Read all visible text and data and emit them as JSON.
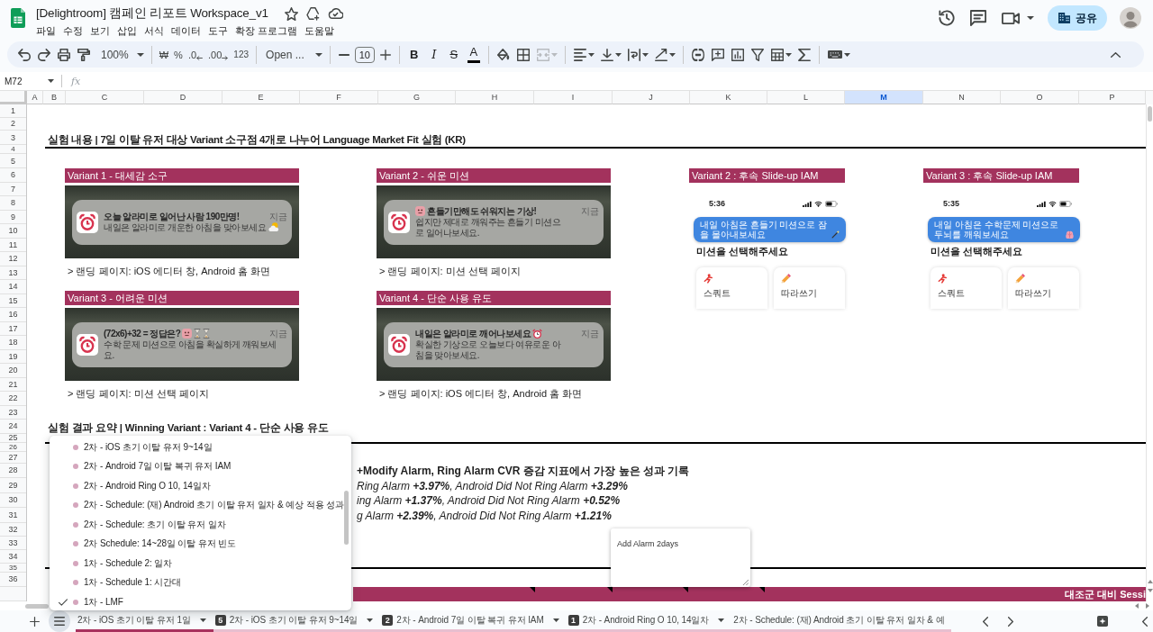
{
  "app": {
    "title": "[Delightroom] 캠페인 리포트 Workspace_v1",
    "menu": [
      "파일",
      "수정",
      "보기",
      "삽입",
      "서식",
      "데이터",
      "도구",
      "확장 프로그램",
      "도움말"
    ],
    "share_button": "공유"
  },
  "toolbar": {
    "zoom": "100%",
    "currency": "₩",
    "percent": "%",
    "decrease_decimals": ".0",
    "increase_decimals": ".00",
    "number_format": "123",
    "font": "Open ...",
    "font_size": "10",
    "bold": "B",
    "italic": "I",
    "strikethrough": "S",
    "text_color": "A",
    "merge_disabled": true
  },
  "formula_bar": {
    "cell": "M72",
    "fx": "fx"
  },
  "columns": [
    {
      "label": "A",
      "selected": false
    },
    {
      "label": "B",
      "selected": false
    },
    {
      "label": "C",
      "selected": false
    },
    {
      "label": "D",
      "selected": false
    },
    {
      "label": "E",
      "selected": false
    },
    {
      "label": "F",
      "selected": false
    },
    {
      "label": "G",
      "selected": false
    },
    {
      "label": "H",
      "selected": false
    },
    {
      "label": "I",
      "selected": false
    },
    {
      "label": "J",
      "selected": false
    },
    {
      "label": "K",
      "selected": false
    },
    {
      "label": "L",
      "selected": false
    },
    {
      "label": "M",
      "selected": true
    },
    {
      "label": "N",
      "selected": false
    },
    {
      "label": "O",
      "selected": false
    },
    {
      "label": "P",
      "selected": false
    }
  ],
  "rows": [
    "1",
    "2",
    "3",
    "4",
    "5",
    "6",
    "7",
    "8",
    "9",
    "10",
    "11",
    "12",
    "13",
    "14",
    "15",
    "16",
    "17",
    "18",
    "19",
    "20",
    "21",
    "22",
    "23",
    "24",
    "25",
    "26",
    "27",
    "28",
    "29",
    "30",
    "31",
    "32",
    "33",
    "34",
    "35",
    "36"
  ],
  "sheet": {
    "heading": "실험 내용 | 7일 이탈 유저 대상 Variant 소구점 4개로 나누어 Language Market Fit 실험 (KR)",
    "variants": [
      {
        "title": "Variant 1 - 대세감 소구",
        "notification": {
          "title": "오늘 알라미로 일어난 사람 190만명!",
          "body": "내일은 알라미로 개운한 아침을 맞아보세요",
          "time": "지금"
        },
        "caption": "> 랜딩 페이지: iOS 에디터 창, Android 홈 화면"
      },
      {
        "title": "Variant 2 - 쉬운 미션",
        "notification": {
          "title": "흔들기만해도 쉬워지는 기상!",
          "body": "쉽지만 제대로 깨워주는 흔들기 미션으로 일어나보세요.",
          "time": "지금"
        },
        "caption": "> 랜딩 페이지: 미션 선택 페이지"
      },
      {
        "title": "Variant 3 - 어려운 미션",
        "notification": {
          "title": "(72x6)+32 = 정답은?",
          "body": "수학 문제 미션으로 아침을 확실하게 깨워보세요.",
          "time": "지금"
        },
        "caption": "> 랜딩 페이지: 미션 선택 페이지"
      },
      {
        "title": "Variant 4 - 단순 사용 유도",
        "notification": {
          "title": "내일은 알라미로 깨어나보세요",
          "body": "확실한 기상으로 오늘보다 여유로운 아침을 맞아보세요.",
          "time": "지금"
        },
        "caption": "> 랜딩 페이지: iOS 에디터 창, Android 홈 화면"
      }
    ],
    "iam_variants": [
      {
        "title": "Variant 2 : 후속 Slide-up IAM",
        "time": "5:36",
        "banner": "내일 아침은 흔들기 미션으로 잠을 몰아내보세요",
        "heading": "미션을 선택해주세요",
        "missions": [
          "스쿼트",
          "따라쓰기"
        ]
      },
      {
        "title": "Variant 3 : 후속 Slide-up IAM",
        "time": "5:35",
        "banner": "내일 아침은 수학문제 미션으로 두뇌를 깨워보세요",
        "heading": "미션을 선택해주세요",
        "missions": [
          "스쿼트",
          "따라쓰기"
        ]
      }
    ],
    "result_heading": "실험 결과 요약 | Winning Variant : Variant 4 - 단순 사용 유도",
    "result_lines": [
      {
        "kind": "summary",
        "text": "+Modify Alarm, Ring Alarm CVR 증감 지표에서 가장 높은 성과 기록"
      },
      {
        "kind": "metric",
        "text": "Ring Alarm **+3.97%**, Android Did Not Ring Alarm **+3.29%**"
      },
      {
        "kind": "metric",
        "text": "ing Alarm **+1.37%**, Android Did Not Ring Alarm **+0.52%**"
      },
      {
        "kind": "metric",
        "text": "g Alarm **+2.39%**, Android Did Not Ring Alarm **+1.21%**"
      }
    ],
    "note": "Add Alarm 2days",
    "footer_bar": "대조군 대비 Sessi"
  },
  "sheet_menu": {
    "items": [
      {
        "label": "2차 - iOS 초기 이탈 유저 9~14일",
        "selected": false
      },
      {
        "label": "2차 - Android 7일 이탈 복귀 유저 IAM",
        "selected": false
      },
      {
        "label": "2차 - Android Ring O 10, 14일차",
        "selected": false
      },
      {
        "label": "2차 - Schedule: (재) Android 초기 이탈 유저 일차 & 예상 적용 성과",
        "selected": false
      },
      {
        "label": "2차 - Schedule: 초기 이탈 유저 일차",
        "selected": false
      },
      {
        "label": "2차 Schedule: 14~28일 이탈 유저 빈도",
        "selected": false
      },
      {
        "label": "1차 - Schedule 2: 일차",
        "selected": false
      },
      {
        "label": "1차 - Schedule 1: 시간대",
        "selected": false
      },
      {
        "label": "1차 - LMF",
        "selected": true
      }
    ]
  },
  "sheet_tabs": [
    {
      "label": "2차 - iOS 초기 이탈 유저 1일",
      "color": "#a8325e",
      "selected": false
    },
    {
      "badge": "5",
      "label": "2차 - iOS 초기 이탈 유저 9~14일",
      "color": "#e8bfd0",
      "selected": false
    },
    {
      "badge": "2",
      "label": "2차 - Android 7일 이탈 복귀 유저 IAM",
      "color": "#e8bfd0",
      "selected": false
    },
    {
      "badge": "1",
      "label": "2차 - Android Ring O 10, 14일차",
      "color": "#e8bfd0",
      "selected": false
    },
    {
      "label": "2차 - Schedule: (재) Android 초기 이탈 유저 일차 & 예",
      "color": "#e8bfd0",
      "selected": false
    }
  ]
}
